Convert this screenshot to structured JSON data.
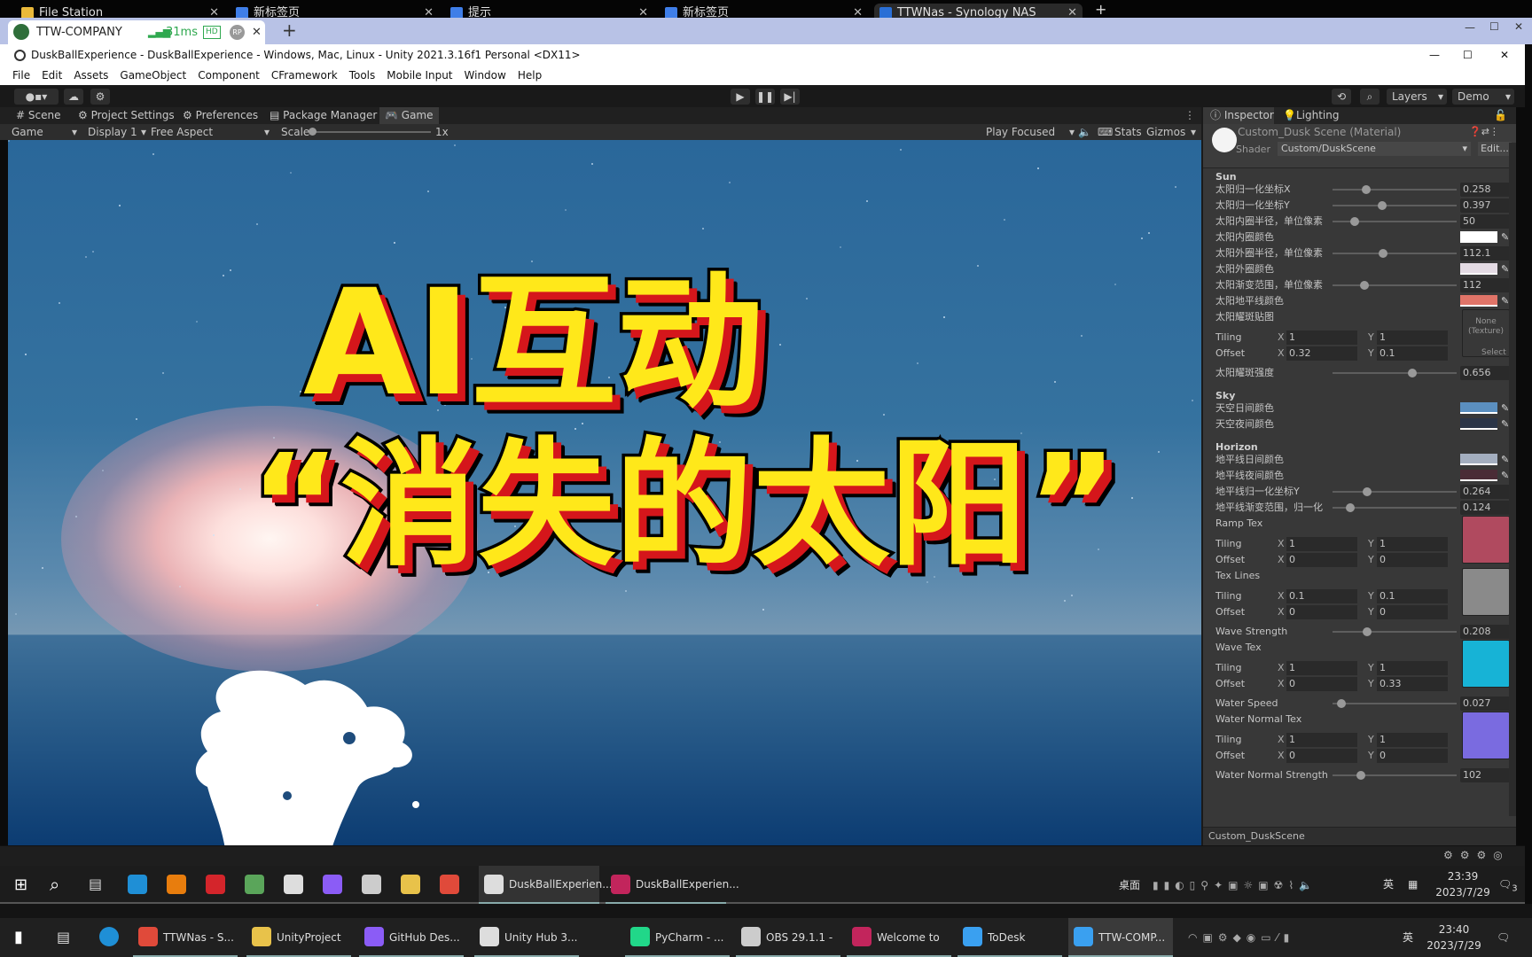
{
  "browser_tabs": [
    {
      "label": "File Station",
      "icon": "folder-icon",
      "color": "#e9b93a"
    },
    {
      "label": "新标签页",
      "icon": "page-icon",
      "color": "#3f7ee8"
    },
    {
      "label": "提示",
      "icon": "back-icon",
      "color": "#3f7ee8"
    },
    {
      "label": "新标签页",
      "icon": "page-icon",
      "color": "#3f7ee8"
    },
    {
      "label": "TTWNas - Synology NAS",
      "icon": "dsm-icon",
      "color": "#2a6fd6"
    }
  ],
  "remote": {
    "tab_label": "TTW-COMPANY",
    "latency": "31ms",
    "hd": "HD",
    "rp": "RP",
    "new_tab": "+"
  },
  "window": {
    "title": "DuskBallExperience - DuskBallExperience - Windows, Mac, Linux - Unity 2021.3.16f1 Personal <DX11>"
  },
  "menu": [
    "File",
    "Edit",
    "Assets",
    "GameObject",
    "Component",
    "CFramework",
    "Tools",
    "Mobile Input",
    "Window",
    "Help"
  ],
  "toolbar": {
    "layers": "Layers",
    "layout": "Demo"
  },
  "dock_tabs": [
    {
      "label": "Scene",
      "icon": "#"
    },
    {
      "label": "Project Settings",
      "icon": "⚙"
    },
    {
      "label": "Preferences",
      "icon": "⚙"
    },
    {
      "label": "Package Manager",
      "icon": "▤"
    },
    {
      "label": "Game",
      "icon": "🎮"
    }
  ],
  "game_toolbar": {
    "view": "Game",
    "display": "Display 1",
    "aspect": "Free Aspect",
    "scale_label": "Scale",
    "scale_value": "1x",
    "play_mode": "Play Focused",
    "stats": "Stats",
    "gizmos": "Gizmos"
  },
  "overlay": {
    "line1": "AI互动",
    "line2": "“消失的太阳”",
    "fill": "#ffe81a",
    "shadow": "#d5161b"
  },
  "inspector": {
    "tabs": [
      "Inspector",
      "Lighting"
    ],
    "material_title": "Custom_Dusk Scene (Material)",
    "shader_label": "Shader",
    "shader_value": "Custom/DuskScene",
    "edit_label": "Edit...",
    "footer_label": "Custom_DuskScene",
    "rows": [
      {
        "type": "header",
        "label": "Sun"
      },
      {
        "type": "slider",
        "label": "太阳归一化坐标X",
        "value": "0.258",
        "level": 0.27
      },
      {
        "type": "slider",
        "label": "太阳归一化坐标Y",
        "value": "0.397",
        "level": 0.4
      },
      {
        "type": "slider",
        "label": "太阳内圈半径，单位像素",
        "value": "50",
        "level": 0.18
      },
      {
        "type": "color",
        "label": "太阳内圈颜色",
        "color": "#ffffff"
      },
      {
        "type": "slider",
        "label": "太阳外圈半径，单位像素",
        "value": "112.1",
        "level": 0.41
      },
      {
        "type": "color",
        "label": "太阳外圈颜色",
        "color": "#e4dbe4"
      },
      {
        "type": "slider",
        "label": "太阳渐变范围，单位像素",
        "value": "112",
        "level": 0.26
      },
      {
        "type": "color",
        "label": "太阳地平线颜色",
        "color": "#e07468"
      },
      {
        "type": "texture",
        "label": "太阳耀斑贴图",
        "tex_text": "None\n(Texture)",
        "color": "#383838",
        "select": "Select"
      },
      {
        "type": "tiling",
        "label": "Tiling",
        "x": "1",
        "y": "1"
      },
      {
        "type": "tiling",
        "label": "Offset",
        "x": "0.32",
        "y": "0.1"
      },
      {
        "type": "slider",
        "label": "太阳耀斑强度",
        "value": "0.656",
        "level": 0.64
      },
      {
        "type": "header",
        "label": "Sky"
      },
      {
        "type": "color",
        "label": "天空日间颜色",
        "color": "#5b8fbf"
      },
      {
        "type": "color",
        "label": "天空夜间颜色",
        "color": "#2b3547"
      },
      {
        "type": "header",
        "label": "Horizon"
      },
      {
        "type": "color",
        "label": "地平线日间颜色",
        "color": "#a3aebf"
      },
      {
        "type": "color",
        "label": "地平线夜间颜色",
        "color": "#4a2c36"
      },
      {
        "type": "slider",
        "label": "地平线归一化坐标Y",
        "value": "0.264",
        "level": 0.28
      },
      {
        "type": "slider",
        "label": "地平线渐变范围，归一化",
        "value": "0.124",
        "level": 0.14
      },
      {
        "type": "texture",
        "label": "Ramp Tex",
        "tex_text": "",
        "color": "#b04a5f"
      },
      {
        "type": "tiling",
        "label": "Tiling",
        "x": "1",
        "y": "1"
      },
      {
        "type": "tiling",
        "label": "Offset",
        "x": "0",
        "y": "0"
      },
      {
        "type": "texture",
        "label": "Tex Lines",
        "tex_text": "",
        "color": "#8a8a8a"
      },
      {
        "type": "tiling",
        "label": "Tiling",
        "x": "0.1",
        "y": "0.1"
      },
      {
        "type": "tiling",
        "label": "Offset",
        "x": "0",
        "y": "0"
      },
      {
        "type": "slider",
        "label": "Wave Strength",
        "value": "0.208",
        "level": 0.28
      },
      {
        "type": "texture",
        "label": "Wave Tex",
        "tex_text": "",
        "color": "#17b3d6"
      },
      {
        "type": "tiling",
        "label": "Tiling",
        "x": "1",
        "y": "1"
      },
      {
        "type": "tiling",
        "label": "Offset",
        "x": "0",
        "y": "0.33"
      },
      {
        "type": "slider",
        "label": "Water Speed",
        "value": "0.027",
        "level": 0.07
      },
      {
        "type": "texture",
        "label": "Water Normal Tex",
        "tex_text": "",
        "color": "#7a6be0"
      },
      {
        "type": "tiling",
        "label": "Tiling",
        "x": "1",
        "y": "1"
      },
      {
        "type": "tiling",
        "label": "Offset",
        "x": "0",
        "y": "0"
      },
      {
        "type": "slider",
        "label": "Water Normal Strength",
        "value": "102",
        "level": 0.23
      }
    ]
  },
  "taskbar_inner": {
    "pinned": [
      {
        "icon": "edge-icon",
        "color": "#1f8fd6"
      },
      {
        "icon": "blender-icon",
        "color": "#e87d0d"
      },
      {
        "icon": "youdao-icon",
        "color": "#d4252b"
      },
      {
        "icon": "app-icon",
        "color": "#5aa55a"
      },
      {
        "icon": "unity-hub-icon",
        "color": "#dddddd"
      },
      {
        "icon": "github-icon",
        "color": "#8b5cf6"
      },
      {
        "icon": "explorer-icon",
        "color": "#cccccc"
      },
      {
        "icon": "files-icon",
        "color": "#e8c24a"
      },
      {
        "icon": "chrome-icon",
        "color": "#e04a3a"
      }
    ],
    "apps": [
      {
        "label": "DuskBallExperien...",
        "icon": "unity-icon",
        "color": "#dddddd"
      },
      {
        "label": "DuskBallExperien...",
        "icon": "rider-icon",
        "color": "#c2255c"
      }
    ],
    "desktop_label": "桌面",
    "ime": "英",
    "time": "23:39",
    "date": "2023/7/29",
    "notif": "3"
  },
  "taskbar_outer": {
    "apps": [
      {
        "label": "TTWNas - S...",
        "icon": "chrome-icon",
        "color": "#e04a3a"
      },
      {
        "label": "UnityProject",
        "icon": "folder-icon",
        "color": "#e8c24a"
      },
      {
        "label": "GitHub Des...",
        "icon": "github-icon",
        "color": "#8b5cf6"
      },
      {
        "label": "Unity Hub 3...",
        "icon": "unity-hub-icon",
        "color": "#dddddd"
      },
      {
        "label": "PyCharm - ...",
        "icon": "pycharm-icon",
        "color": "#21d789"
      },
      {
        "label": "OBS 29.1.1 -",
        "icon": "obs-icon",
        "color": "#cccccc"
      },
      {
        "label": "Welcome to",
        "icon": "rider-icon",
        "color": "#c2255c"
      },
      {
        "label": "ToDesk",
        "icon": "todesk-icon",
        "color": "#3aa0f0"
      },
      {
        "label": "TTW-COMP...",
        "icon": "todesk-icon",
        "color": "#3aa0f0"
      }
    ],
    "ime": "英",
    "time": "23:40",
    "date": "2023/7/29"
  }
}
